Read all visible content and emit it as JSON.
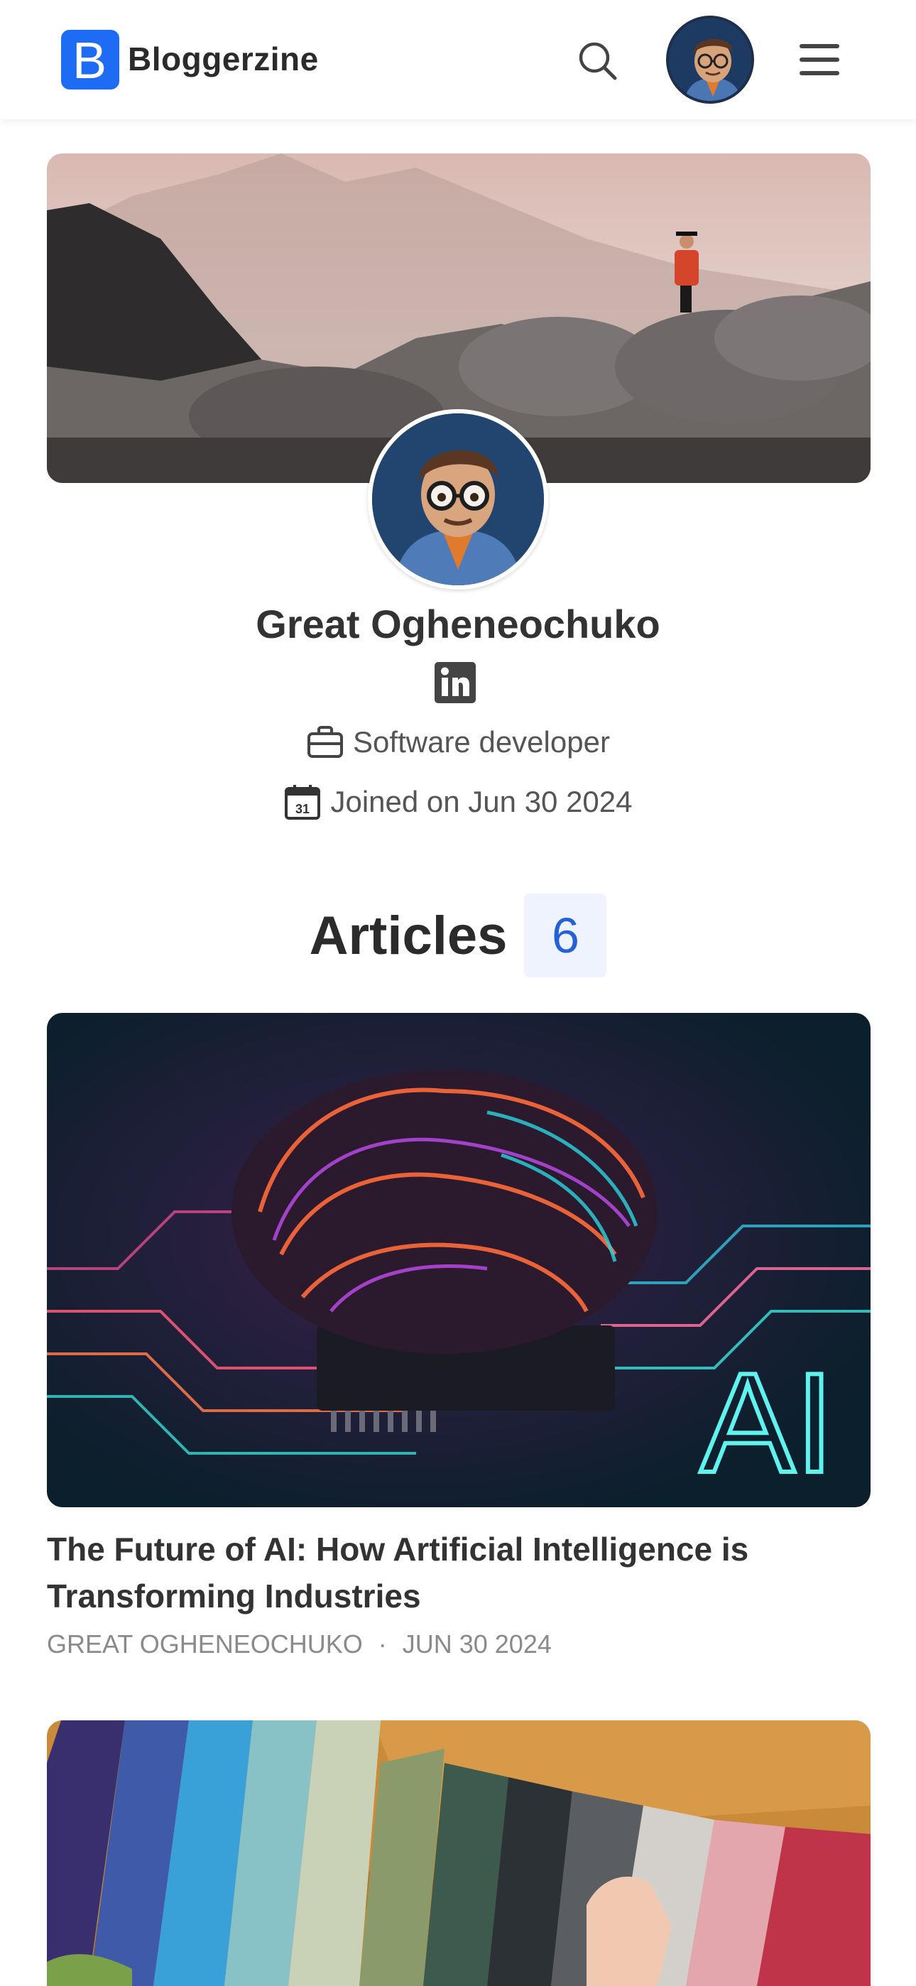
{
  "app": {
    "logo_letter": "B",
    "name": "Bloggerzine"
  },
  "header": {
    "icons": [
      "search-icon",
      "avatar",
      "hamburger-menu-icon"
    ]
  },
  "profile": {
    "name": "Great Ogheneochuko",
    "social": "linkedin-icon",
    "occupation": "Software developer",
    "joined": "Joined on Jun 30 2024",
    "calendar_day": "31"
  },
  "articles": {
    "title": "Articles",
    "count": "6",
    "items": [
      {
        "title": "The Future of AI: How Artificial Intelligence is Transforming Industries",
        "author": "GREAT OGHENEOCHUKO",
        "separator": "·",
        "date": "JUN 30 2024",
        "image_text": "AI"
      },
      {
        "title": "",
        "author": "",
        "date": ""
      }
    ]
  },
  "colors": {
    "brand": "#1f6cf4",
    "count_bg": "#eef3fd",
    "count_text": "#2461d8"
  }
}
